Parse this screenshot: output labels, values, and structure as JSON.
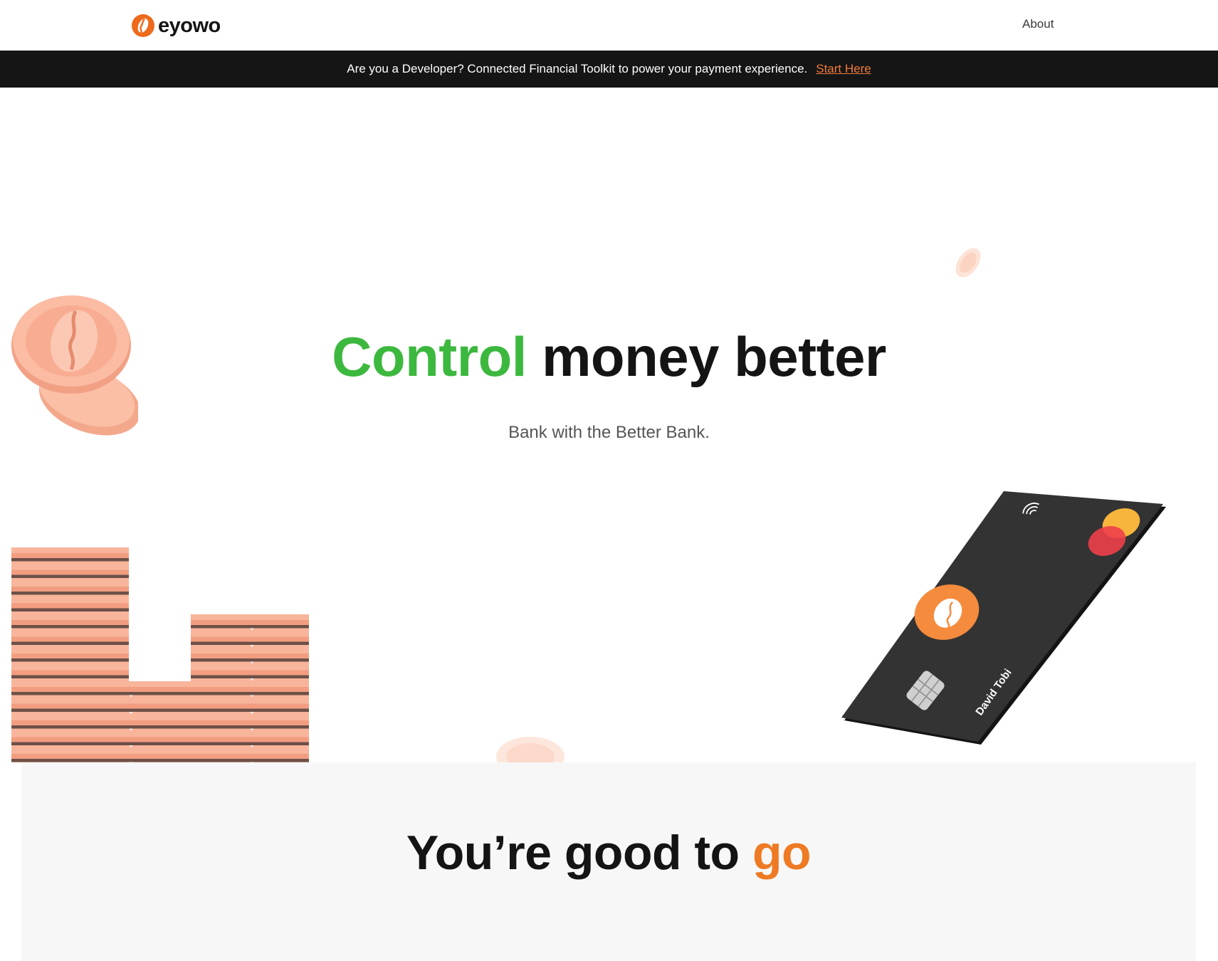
{
  "header": {
    "logo_text": "eyowo",
    "nav": {
      "about_label": "About"
    }
  },
  "dev_banner": {
    "message": "Are you a Developer? Connected Financial Toolkit to power your payment experience.",
    "cta_label": "Start Here"
  },
  "hero": {
    "title_highlight": "Control",
    "title_rest": "money better",
    "subtitle": "Bank with the Better Bank."
  },
  "card": {
    "holder_name": "David Tobi"
  },
  "good_section": {
    "title_start": "You’re good to",
    "title_highlight": "go"
  },
  "colors": {
    "brand_orange": "#ee7a23",
    "accent_green": "#3cb83f",
    "banner_bg": "#151515",
    "coin_peach": "#f8b29a"
  },
  "icons": [
    "eyowo-logo-icon",
    "contactless-icon",
    "card-chip-icon",
    "mastercard-icon"
  ]
}
